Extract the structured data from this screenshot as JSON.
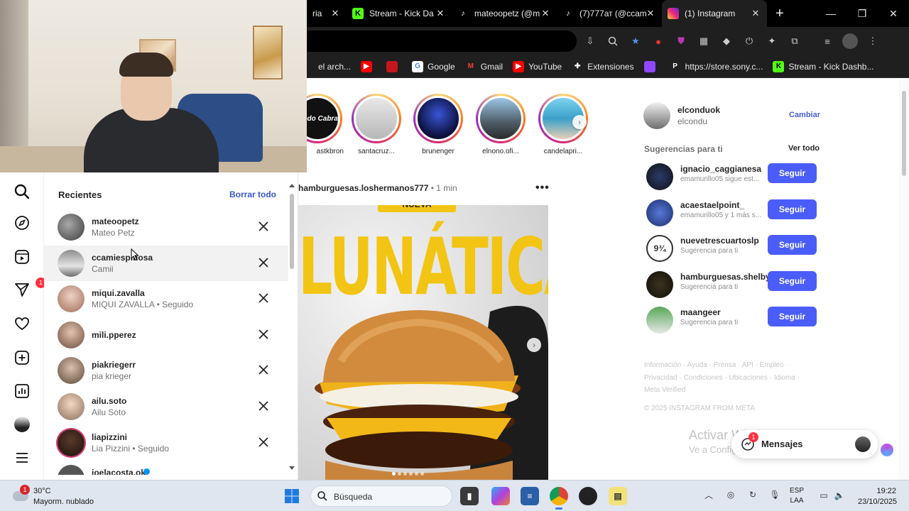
{
  "browser": {
    "tabs": [
      {
        "title": "ria",
        "icon": "generic-tab-icon",
        "active": false
      },
      {
        "title": "Stream - Kick Da",
        "icon": "kick-icon",
        "active": false
      },
      {
        "title": "mateoopetz (@m",
        "icon": "tiktok-icon",
        "active": false
      },
      {
        "title": "(7)777ат (@ccam",
        "icon": "tiktok-icon",
        "active": false
      },
      {
        "title": "(1) Instagram",
        "icon": "instagram-icon",
        "active": true
      }
    ],
    "new_tab": "+",
    "bookmarks": [
      {
        "label": "el arch...",
        "icon": "folder-icon"
      },
      {
        "label": "",
        "icon": "youtube-icon"
      },
      {
        "label": "",
        "icon": "red-shield-icon"
      },
      {
        "label": "Google",
        "icon": "google-icon"
      },
      {
        "label": "Gmail",
        "icon": "gmail-icon"
      },
      {
        "label": "YouTube",
        "icon": "youtube-icon"
      },
      {
        "label": "Extensiones",
        "icon": "puzzle-icon"
      },
      {
        "label": "",
        "icon": "twitch-icon"
      },
      {
        "label": "https://store.sony.c...",
        "icon": "playstation-icon"
      },
      {
        "label": "Stream - Kick Dashb...",
        "icon": "kick-icon"
      }
    ]
  },
  "search_panel": {
    "heading": "Recientes",
    "clear_all": "Borrar todo",
    "items": [
      {
        "user": "mateoopetz",
        "sub": "Mateo Petz",
        "ring": false
      },
      {
        "user": "ccamiespinosa",
        "sub": "Camii",
        "ring": false
      },
      {
        "user": "miqui.zavalla",
        "sub": "MIQUI ZAVALLA • Seguido",
        "ring": false
      },
      {
        "user": "mili.pperez",
        "sub": "",
        "ring": false
      },
      {
        "user": "piakriegerr",
        "sub": "pia krieger",
        "ring": false
      },
      {
        "user": "ailu.soto",
        "sub": "Ailu Soto",
        "ring": false
      },
      {
        "user": "liapizzini",
        "sub": "Lia Pizzini • Seguido",
        "ring": true
      },
      {
        "user": "joelacosta.ok",
        "sub": "",
        "ring": false
      }
    ]
  },
  "nav": {
    "messages_badge": "1"
  },
  "stories": [
    {
      "name": "astkbron",
      "label": "Modo Cabra"
    },
    {
      "name": "santacruz...",
      "label": ""
    },
    {
      "name": "brunenger",
      "label": ""
    },
    {
      "name": "elnono.ofi...",
      "label": ""
    },
    {
      "name": "candelapri...",
      "label": ""
    }
  ],
  "post": {
    "user": "hamburguesas.loshermanos777",
    "time": " • 1 min",
    "more": "•••",
    "tag": "NUEVA",
    "title": "LUNÁTICA"
  },
  "me": {
    "user": "elconduok",
    "name": "elcondu",
    "switch": "Cambiar"
  },
  "suggestions": {
    "title": "Sugerencias para ti",
    "see_all": "Ver todo",
    "follow_label": "Seguir",
    "items": [
      {
        "user": "ignacio_caggianesa",
        "sub": "emamurillo05 sigue est..."
      },
      {
        "user": "acaestaelpoint_",
        "sub": "emamurillo05 y 1 más s..."
      },
      {
        "user": "nuevetrescuartoslp",
        "sub": "Sugerencia para ti"
      },
      {
        "user": "hamburguesas.shelby",
        "sub": "Sugerencia para ti"
      },
      {
        "user": "maangeer",
        "sub": "Sugerencia para ti"
      }
    ]
  },
  "footer": {
    "line1": "Información · Ayuda · Prensa · API · Empleo ·",
    "line2": "Privacidad · Condiciones · Ubicaciones · Idioma ·",
    "line3": "Meta Verified",
    "copyright": "© 2025 INSTAGRAM FROM META"
  },
  "watermark": {
    "line1": "Activar Windows",
    "line2": "Ve a Configuración para activar Windows."
  },
  "messages": {
    "label": "Mensajes",
    "badge": "1"
  },
  "taskbar": {
    "weather_temp": "30°C",
    "weather_desc": "Mayorm. nublado",
    "weather_badge": "1",
    "search_placeholder": "Búsqueda",
    "lang_line1": "ESP",
    "lang_line2": "LAA",
    "time": "19:22",
    "date": "23/10/2025"
  },
  "colors": {
    "instagram_blue": "#4a5df9",
    "link_blue": "#3a58c9",
    "badge_red": "#ff3040",
    "kick_green": "#53fc18"
  }
}
